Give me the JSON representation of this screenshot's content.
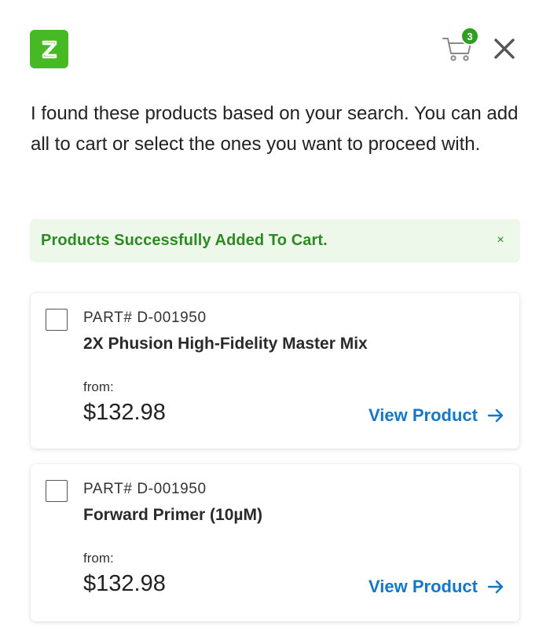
{
  "header": {
    "logo_letter": "Z",
    "cart_count": "3",
    "brand_color": "#47b924"
  },
  "intro_text": "I found these products based on your search. You can add all to cart or select the ones you want to proceed with.",
  "alert": {
    "message": "Products Successfully Added To Cart.",
    "close_glyph": "×"
  },
  "products": [
    {
      "part": "PART# D-001950",
      "name": "2X Phusion High-Fidelity Master Mix",
      "from_label": "from:",
      "price": "$132.98",
      "link_label": "View Product",
      "checked": false
    },
    {
      "part": "PART# D-001950",
      "name": "Forward Primer (10µM)",
      "from_label": "from:",
      "price": "$132.98",
      "link_label": "View Product",
      "checked": false
    }
  ],
  "icons": {
    "cart": "cart-icon",
    "close": "close-icon",
    "arrow": "arrow-right-icon"
  },
  "colors": {
    "accent_green": "#47b924",
    "alert_green": "#2d8a23",
    "alert_bg": "#eef8ea",
    "link_blue": "#1477c9"
  }
}
